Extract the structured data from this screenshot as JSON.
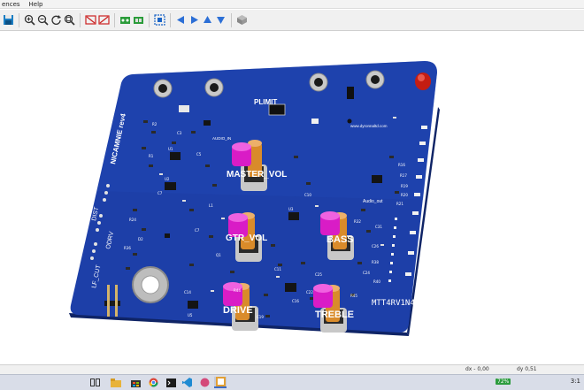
{
  "menu": {
    "items": [
      "ences",
      "Help"
    ]
  },
  "toolbar": {
    "icons": [
      "save-icon",
      "zoom-in-icon",
      "zoom-out-icon",
      "zoom-redraw-icon",
      "zoom-fit-icon",
      "hide-copper-back-icon",
      "hide-copper-front-icon",
      "show-through-holes-icon",
      "show-smd-icon",
      "hide-virtual-icon",
      "arrow-left-icon",
      "arrow-right-icon",
      "arrow-up-icon",
      "arrow-down-icon",
      "render-3d-icon"
    ]
  },
  "board": {
    "labels": {
      "plimit": "PLIMIT",
      "master_vol": "MASTER_VOL",
      "gtr_vol": "GTR_VOL",
      "bass": "BASS",
      "drive": "DRIVE",
      "treble": "TREBLE",
      "revision": "MTT4RV1N4",
      "vert_name": "NICAMNIE rev4",
      "odrv": "ODRV",
      "dist": "DIST",
      "lf_cut": "LF_CUT",
      "url": "www.dyronnaltd.com",
      "audio_out": "Audio_out",
      "audio_in": "AUDIO_IN",
      "refs": [
        "R2",
        "R16",
        "R17",
        "R19",
        "R20",
        "R21",
        "R32",
        "R44",
        "R45",
        "C3",
        "C5",
        "C7",
        "C10",
        "C11",
        "C14",
        "C16",
        "C19",
        "C22",
        "C24",
        "C25",
        "C26",
        "U1",
        "U2",
        "U3",
        "U5",
        "Q1",
        "L1",
        "D2",
        "C7",
        "R1",
        "R24",
        "R36",
        "R38",
        "R40",
        "C31"
      ]
    },
    "colors": {
      "mask": "#1d3fa8",
      "mask_shade": "#16328a",
      "knob": "#e91ed2",
      "shaft": "#d98b2a",
      "silk": "#ffffff"
    }
  },
  "status": {
    "dx": "dx - 0,00",
    "dy": "dy 0,51"
  },
  "taskbar": {
    "battery": "72%",
    "time": "3:1"
  }
}
